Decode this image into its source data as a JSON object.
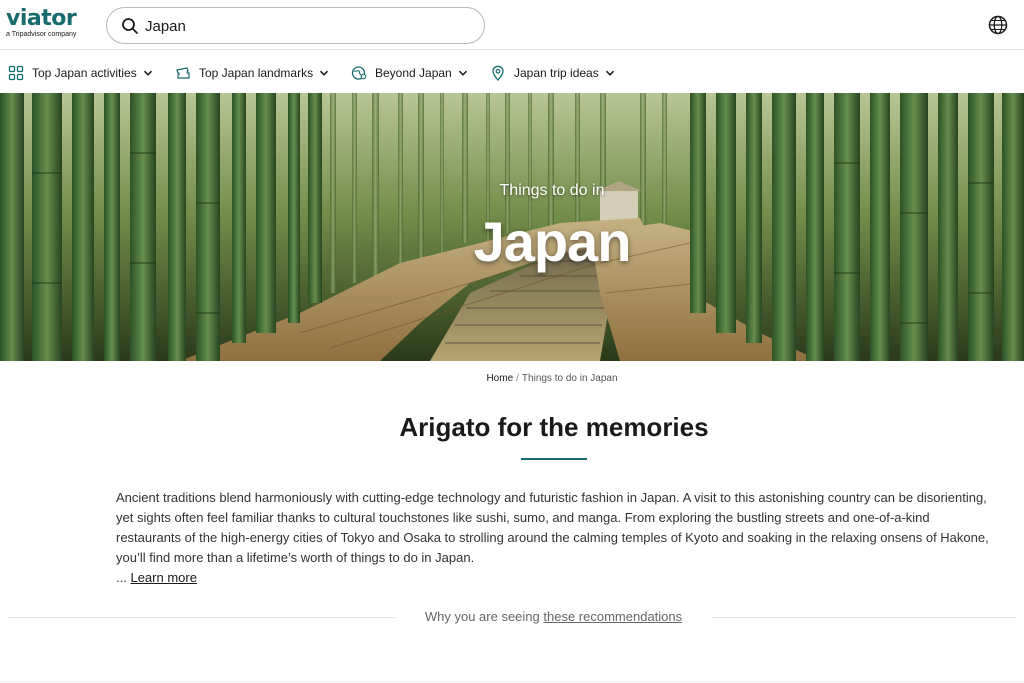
{
  "brand": {
    "name": "viator",
    "tagline": "a Tripadvisor company",
    "color": "#186b6d"
  },
  "search": {
    "value": "Japan",
    "icon": "search-icon"
  },
  "header": {
    "language_icon": "globe-icon"
  },
  "nav": {
    "items": [
      {
        "label": "Top Japan activities",
        "icon": "grid-icon"
      },
      {
        "label": "Top Japan landmarks",
        "icon": "ticket-icon"
      },
      {
        "label": "Beyond Japan",
        "icon": "globe-pin-icon"
      },
      {
        "label": "Japan trip ideas",
        "icon": "map-pin-icon"
      }
    ]
  },
  "hero": {
    "subtitle": "Things to do in",
    "title": "Japan"
  },
  "breadcrumb": {
    "home": "Home",
    "separator": "/",
    "current": "Things to do in Japan"
  },
  "main": {
    "heading": "Arigato for the memories",
    "intro": "Ancient traditions blend harmoniously with cutting-edge technology and futuristic fashion in Japan. A visit to this astonishing country can be disorienting, yet sights often feel familiar thanks to cultural touchstones like sushi, sumo, and manga. From exploring the bustling streets and one-of-a-kind restaurants of the high-energy cities of Tokyo and Osaka to strolling around the calming temples of Kyoto and soaking in the relaxing onsens of Hakone, you’ll find more than a lifetime’s worth of things to do in Japan.",
    "ellipsis": "...",
    "learn_more": "Learn more"
  },
  "recommendations": {
    "prefix": "Why you are seeing",
    "link": "these recommendations"
  }
}
